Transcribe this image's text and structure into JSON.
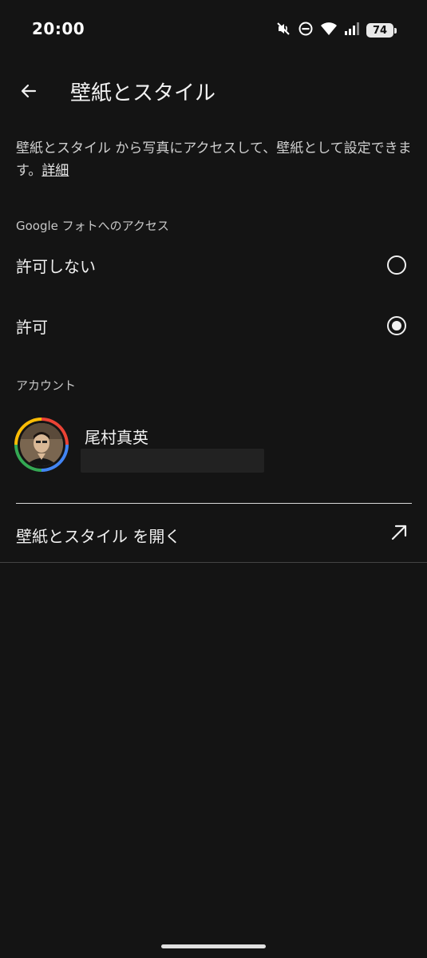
{
  "status_bar": {
    "time": "20:00",
    "battery": "74",
    "icons": [
      "mute-icon",
      "dnd-icon",
      "wifi-icon",
      "signal-icon",
      "battery-icon"
    ]
  },
  "app_bar": {
    "back_icon": "arrow-back-icon",
    "title": "壁紙とスタイル"
  },
  "description": {
    "text": "壁紙とスタイル から写真にアクセスして、壁紙として設定できます。",
    "link": "詳細"
  },
  "access": {
    "label": "Google フォトへのアクセス",
    "options": [
      {
        "label": "許可しない",
        "selected": false
      },
      {
        "label": "許可",
        "selected": true
      }
    ]
  },
  "account": {
    "label": "アカウント",
    "name": "尾村真英"
  },
  "open_action": {
    "label": "壁紙とスタイル を開く",
    "icon": "open-external-icon"
  },
  "colors": {
    "background": "#141414",
    "text": "#f0f0f0",
    "google_red": "#ea4335",
    "google_blue": "#4285f4",
    "google_green": "#34a853",
    "google_yellow": "#fbbc05"
  }
}
